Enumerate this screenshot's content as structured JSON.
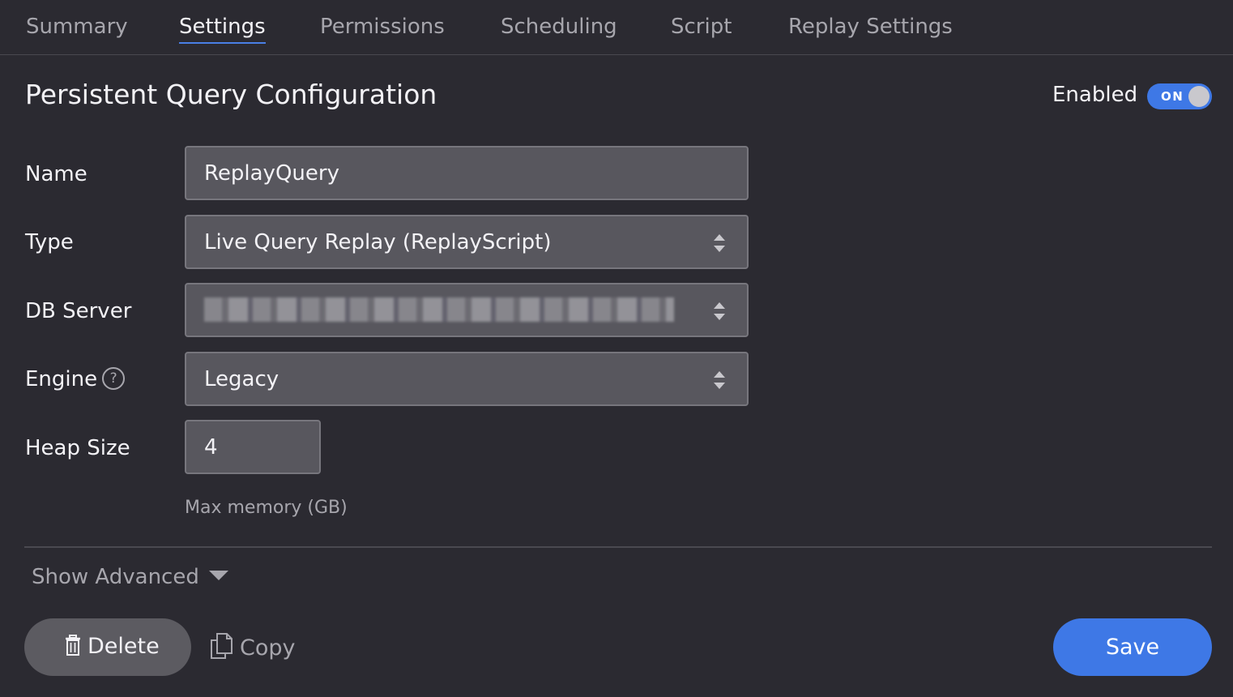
{
  "tabs": [
    {
      "label": "Summary",
      "active": false
    },
    {
      "label": "Settings",
      "active": true
    },
    {
      "label": "Permissions",
      "active": false
    },
    {
      "label": "Scheduling",
      "active": false
    },
    {
      "label": "Script",
      "active": false
    },
    {
      "label": "Replay Settings",
      "active": false
    }
  ],
  "header": {
    "title": "Persistent Query Configuration",
    "enabled_label": "Enabled",
    "toggle_text": "ON"
  },
  "form": {
    "name": {
      "label": "Name",
      "value": "ReplayQuery"
    },
    "type": {
      "label": "Type",
      "value": "Live Query Replay (ReplayScript)"
    },
    "db_server": {
      "label": "DB Server",
      "value": ""
    },
    "engine": {
      "label": "Engine",
      "help_icon": "?",
      "value": "Legacy"
    },
    "heap_size": {
      "label": "Heap Size",
      "value": "4",
      "hint": "Max memory (GB)"
    }
  },
  "advanced": {
    "label": "Show Advanced"
  },
  "actions": {
    "delete_label": "Delete",
    "copy_label": "Copy",
    "save_label": "Save"
  },
  "colors": {
    "background": "#2b2a31",
    "accent": "#3e78e6",
    "field_bg": "#58575e"
  }
}
